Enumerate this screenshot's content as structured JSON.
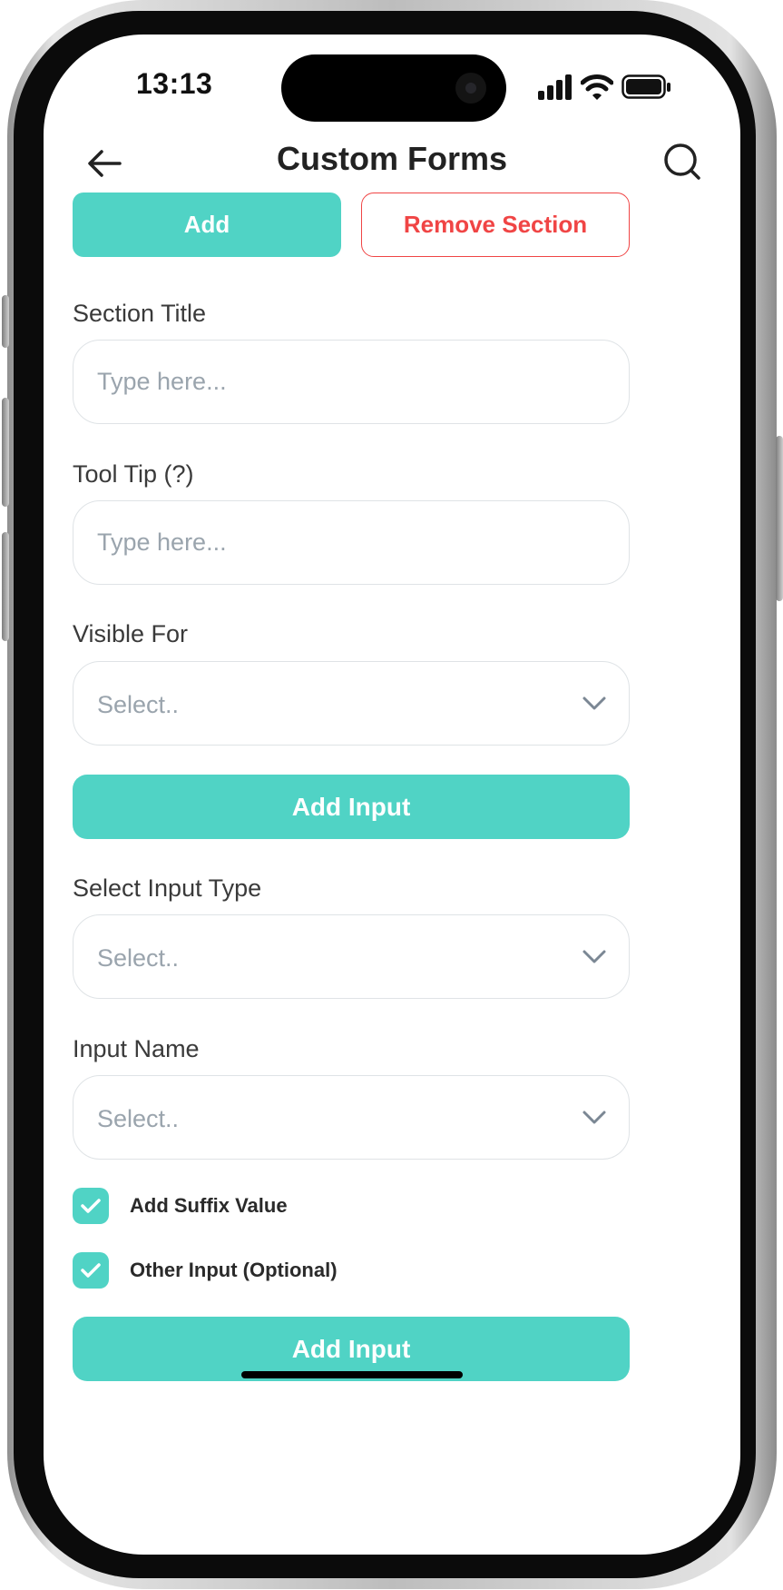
{
  "status_bar": {
    "time": "13:13"
  },
  "header": {
    "title": "Custom Forms",
    "back_icon": "arrow-left-icon",
    "search_icon": "search-icon"
  },
  "actions": {
    "add_label": "Add",
    "remove_section_label": "Remove Section"
  },
  "section_title": {
    "label": "Section Title",
    "placeholder": "Type here..."
  },
  "tool_tip": {
    "label": "Tool Tip (?)",
    "placeholder": "Type here..."
  },
  "visible_for": {
    "label": "Visible For",
    "value": "Select.."
  },
  "add_input_button": {
    "label": "Add Input"
  },
  "select_input_type": {
    "label": "Select Input Type",
    "value": "Select.."
  },
  "input_name": {
    "label": "Input Name",
    "value": "Select.."
  },
  "checkboxes": [
    {
      "label": "Add Suffix Value",
      "checked": true
    },
    {
      "label": "Other Input (Optional)",
      "checked": true
    }
  ],
  "bottom_button": {
    "label": "Add Input"
  },
  "colors": {
    "accent": "#50D3C5",
    "danger": "#F04545",
    "placeholder": "#9AA4AD"
  }
}
